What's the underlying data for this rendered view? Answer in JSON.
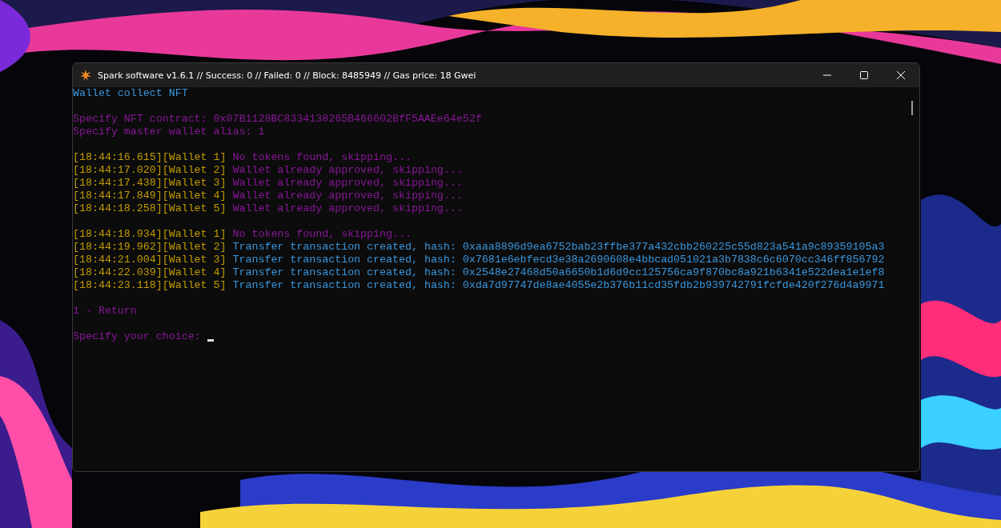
{
  "window": {
    "title": "Spark software v1.6.1 // Success: 0 // Failed: 0 // Block: 8485949 // Gas price: 18 Gwei"
  },
  "console": {
    "blocks": [
      [
        [
          {
            "text": "Wallet collect NFT",
            "color": "#3a96dd"
          }
        ]
      ],
      [
        [
          {
            "text": "Specify NFT contract: 0x07B1128BC8334138265B466602BfF5AAEe64e52f",
            "color": "#881798"
          }
        ],
        [
          {
            "text": "Specify master wallet alias: 1",
            "color": "#881798"
          }
        ]
      ],
      [
        [
          {
            "text": "[18:44:16.615][Wallet 1]",
            "color": "#c19c00"
          },
          {
            "text": "No tokens found, skipping...",
            "color": "#881798"
          }
        ],
        [
          {
            "text": "[18:44:17.020][Wallet 2]",
            "color": "#c19c00"
          },
          {
            "text": "Wallet already approved, skipping...",
            "color": "#881798"
          }
        ],
        [
          {
            "text": "[18:44:17.438][Wallet 3]",
            "color": "#c19c00"
          },
          {
            "text": "Wallet already approved, skipping...",
            "color": "#881798"
          }
        ],
        [
          {
            "text": "[18:44:17.849][Wallet 4]",
            "color": "#c19c00"
          },
          {
            "text": "Wallet already approved, skipping...",
            "color": "#881798"
          }
        ],
        [
          {
            "text": "[18:44:18.258][Wallet 5]",
            "color": "#c19c00"
          },
          {
            "text": "Wallet already approved, skipping...",
            "color": "#881798"
          }
        ]
      ],
      [
        [
          {
            "text": "[18:44:18.934][Wallet 1]",
            "color": "#c19c00"
          },
          {
            "text": "No tokens found, skipping...",
            "color": "#881798"
          }
        ],
        [
          {
            "text": "[18:44:19.962][Wallet 2]",
            "color": "#c19c00"
          },
          {
            "text": "Transfer transaction created, hash: 0xaaa8896d9ea6752bab23ffbe377a432cbb260225c55d823a541a9c89359105a3",
            "color": "#3a96dd"
          }
        ],
        [
          {
            "text": "[18:44:21.004][Wallet 3]",
            "color": "#c19c00"
          },
          {
            "text": "Transfer transaction created, hash: 0x7681e6ebfecd3e38a2690608e4bbcad051021a3b7838c6c6070cc346ff856792",
            "color": "#3a96dd"
          }
        ],
        [
          {
            "text": "[18:44:22.039][Wallet 4]",
            "color": "#c19c00"
          },
          {
            "text": "Transfer transaction created, hash: 0x2548e27468d50a6650b1d6d9cc125756ca9f870bc8a921b6341e522dea1e1ef8",
            "color": "#3a96dd"
          }
        ],
        [
          {
            "text": "[18:44:23.118][Wallet 5]",
            "color": "#c19c00"
          },
          {
            "text": "Transfer transaction created, hash: 0xda7d97747de8ae4055e2b376b11cd35fdb2b939742791fcfde420f276d4a9971",
            "color": "#3a96dd"
          }
        ]
      ],
      [
        [
          {
            "text": "1 - Return",
            "color": "#881798"
          }
        ]
      ]
    ],
    "prompt": {
      "text": "Specify your choice:",
      "color": "#881798",
      "cursor": true
    }
  }
}
